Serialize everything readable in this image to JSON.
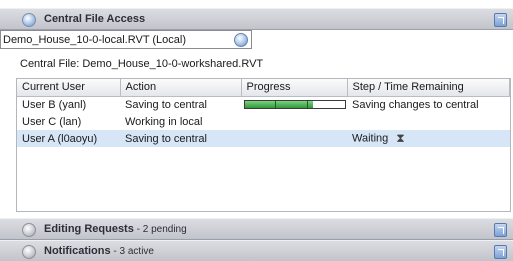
{
  "central_panel": {
    "title": "Central File Access"
  },
  "file_select": {
    "value": "Demo_House_10-0-local.RVT (Local)"
  },
  "central_file": {
    "text": "Central File:  Demo_House_10-0-workshared.RVT"
  },
  "table": {
    "headers": {
      "user": "Current User",
      "action": "Action",
      "progress": "Progress",
      "step": "Step / Time Remaining"
    },
    "rows": [
      {
        "user": "User B (yanl)",
        "action": "Saving to central",
        "progress": 0.68,
        "step": "Saving changes to central"
      },
      {
        "user": "User C (lan)",
        "action": "Working in local",
        "progress": null,
        "step": ""
      },
      {
        "user": "User A (l0aoyu)",
        "action": "Saving to central",
        "progress": null,
        "step": "Waiting"
      }
    ]
  },
  "editing_panel": {
    "title": "Editing Requests",
    "count": " - 2 pending"
  },
  "notifications_panel": {
    "title": "Notifications",
    "count": " - 3 active"
  },
  "colors": {
    "progress_fill": "#2e9a3b",
    "selected_row": "#d6e6f7",
    "header_accent": "#7ea2d6"
  },
  "icons": {
    "central": "central-file-icon",
    "refresh": "refresh-icon",
    "waiting": "hourglass-icon",
    "expand": "expand-button-icon"
  }
}
